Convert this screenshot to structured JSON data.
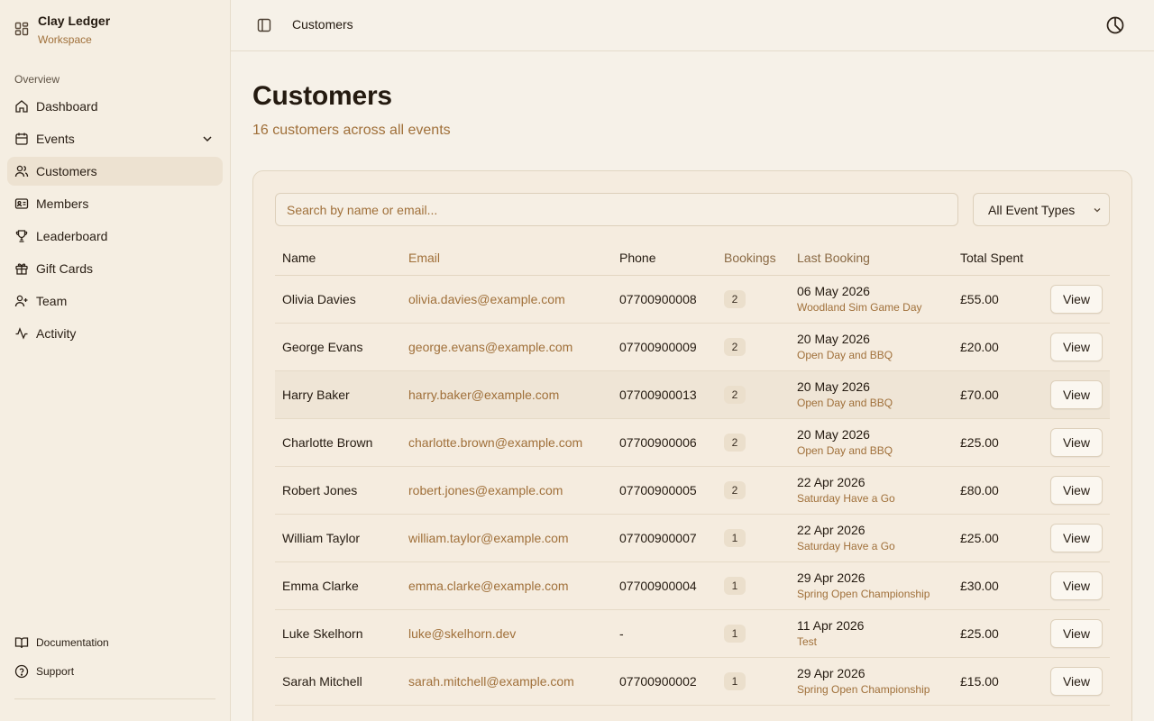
{
  "brand": {
    "title": "Clay Ledger",
    "subtitle": "Workspace"
  },
  "sidebar": {
    "section_label": "Overview",
    "items": [
      {
        "label": "Dashboard",
        "icon": "home-icon"
      },
      {
        "label": "Events",
        "icon": "calendar-icon"
      },
      {
        "label": "Customers",
        "icon": "users-icon",
        "active": true
      },
      {
        "label": "Members",
        "icon": "id-card-icon"
      },
      {
        "label": "Leaderboard",
        "icon": "trophy-icon"
      },
      {
        "label": "Gift Cards",
        "icon": "gift-icon"
      },
      {
        "label": "Team",
        "icon": "user-plus-icon"
      },
      {
        "label": "Activity",
        "icon": "activity-icon"
      }
    ],
    "footer": [
      {
        "label": "Documentation",
        "icon": "book-icon"
      },
      {
        "label": "Support",
        "icon": "help-circle-icon"
      }
    ]
  },
  "header": {
    "title": "Customers"
  },
  "main": {
    "title": "Customers",
    "subtitle": "16 customers across all events",
    "search_placeholder": "Search by name or email...",
    "event_filter": "All Event Types",
    "columns": [
      "Name",
      "Email",
      "Phone",
      "Bookings",
      "Last Booking",
      "Total Spent"
    ],
    "rows": [
      {
        "name": "Olivia Davies",
        "email": "olivia.davies@example.com",
        "phone": "07700900008",
        "bookings": "2",
        "last_date": "06 May 2026",
        "last_event": "Woodland Sim Game Day",
        "total": "£55.00",
        "action": "View"
      },
      {
        "name": "George Evans",
        "email": "george.evans@example.com",
        "phone": "07700900009",
        "bookings": "2",
        "last_date": "20 May 2026",
        "last_event": "Open Day and BBQ",
        "total": "£20.00",
        "action": "View"
      },
      {
        "name": "Harry Baker",
        "email": "harry.baker@example.com",
        "phone": "07700900013",
        "bookings": "2",
        "last_date": "20 May 2026",
        "last_event": "Open Day and BBQ",
        "total": "£70.00",
        "action": "View"
      },
      {
        "name": "Charlotte Brown",
        "email": "charlotte.brown@example.com",
        "phone": "07700900006",
        "bookings": "2",
        "last_date": "20 May 2026",
        "last_event": "Open Day and BBQ",
        "total": "£25.00",
        "action": "View"
      },
      {
        "name": "Robert Jones",
        "email": "robert.jones@example.com",
        "phone": "07700900005",
        "bookings": "2",
        "last_date": "22 Apr 2026",
        "last_event": "Saturday Have a Go",
        "total": "£80.00",
        "action": "View"
      },
      {
        "name": "William Taylor",
        "email": "william.taylor@example.com",
        "phone": "07700900007",
        "bookings": "1",
        "last_date": "22 Apr 2026",
        "last_event": "Saturday Have a Go",
        "total": "£25.00",
        "action": "View"
      },
      {
        "name": "Emma Clarke",
        "email": "emma.clarke@example.com",
        "phone": "07700900004",
        "bookings": "1",
        "last_date": "29 Apr 2026",
        "last_event": "Spring Open Championship",
        "total": "£30.00",
        "action": "View"
      },
      {
        "name": "Luke Skelhorn",
        "email": "luke@skelhorn.dev",
        "phone": "-",
        "bookings": "1",
        "last_date": "11 Apr 2026",
        "last_event": "Test",
        "total": "£25.00",
        "action": "View"
      },
      {
        "name": "Sarah Mitchell",
        "email": "sarah.mitchell@example.com",
        "phone": "07700900002",
        "bookings": "1",
        "last_date": "29 Apr 2026",
        "last_event": "Spring Open Championship",
        "total": "£15.00",
        "action": "View"
      }
    ]
  }
}
